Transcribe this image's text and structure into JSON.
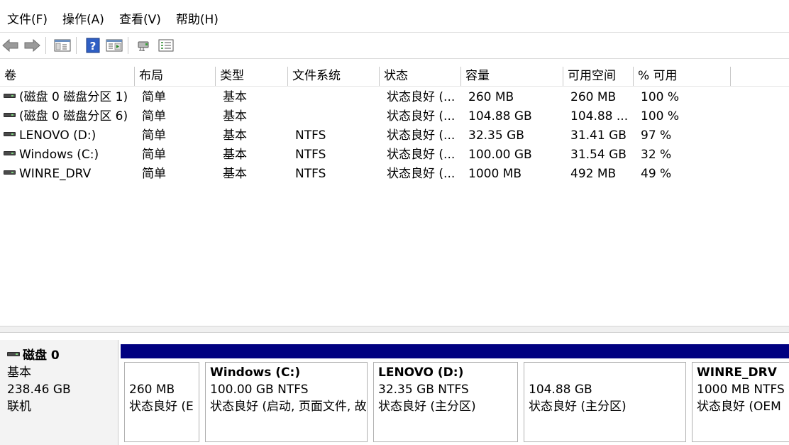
{
  "menu": [
    "文件(F)",
    "操作(A)",
    "查看(V)",
    "帮助(H)"
  ],
  "toolbar": {
    "icons": [
      "back-arrow-icon",
      "forward-arrow-icon",
      "console-tree-icon",
      "help-icon",
      "action-pane-icon",
      "connect-icon",
      "properties-icon"
    ],
    "help_glyph": "?"
  },
  "columns": [
    "卷",
    "布局",
    "类型",
    "文件系统",
    "状态",
    "容量",
    "可用空间",
    "% 可用"
  ],
  "volumes": [
    {
      "name": "(磁盘 0 磁盘分区 1)",
      "layout": "简单",
      "type": "基本",
      "fs": "",
      "status": "状态良好 (...",
      "capacity": "260 MB",
      "free": "260 MB",
      "pct": "100 %"
    },
    {
      "name": "(磁盘 0 磁盘分区 6)",
      "layout": "简单",
      "type": "基本",
      "fs": "",
      "status": "状态良好 (...",
      "capacity": "104.88 GB",
      "free": "104.88 ...",
      "pct": "100 %"
    },
    {
      "name": "LENOVO (D:)",
      "layout": "简单",
      "type": "基本",
      "fs": "NTFS",
      "status": "状态良好 (...",
      "capacity": "32.35 GB",
      "free": "31.41 GB",
      "pct": "97 %"
    },
    {
      "name": "Windows (C:)",
      "layout": "简单",
      "type": "基本",
      "fs": "NTFS",
      "status": "状态良好 (...",
      "capacity": "100.00 GB",
      "free": "31.54 GB",
      "pct": "32 %"
    },
    {
      "name": "WINRE_DRV",
      "layout": "简单",
      "type": "基本",
      "fs": "NTFS",
      "status": "状态良好 (...",
      "capacity": "1000 MB",
      "free": "492 MB",
      "pct": "49 %"
    }
  ],
  "disk": {
    "name": "磁盘 0",
    "type": "基本",
    "size": "238.46 GB",
    "state": "联机",
    "partitions": [
      {
        "name": "",
        "size": "260 MB",
        "status": "状态良好 (E"
      },
      {
        "name": "Windows  (C:)",
        "size": "100.00 GB NTFS",
        "status": "状态良好 (启动, 页面文件, 故"
      },
      {
        "name": "LENOVO  (D:)",
        "size": "32.35 GB NTFS",
        "status": "状态良好 (主分区)"
      },
      {
        "name": "",
        "size": "104.88 GB",
        "status": "状态良好 (主分区)"
      },
      {
        "name": "WINRE_DRV",
        "size": "1000 MB NTFS",
        "status": "状态良好 (OEM"
      }
    ]
  },
  "colors": {
    "partition_bar": "#000080",
    "disk_label_bg": "#f3f3f3"
  }
}
